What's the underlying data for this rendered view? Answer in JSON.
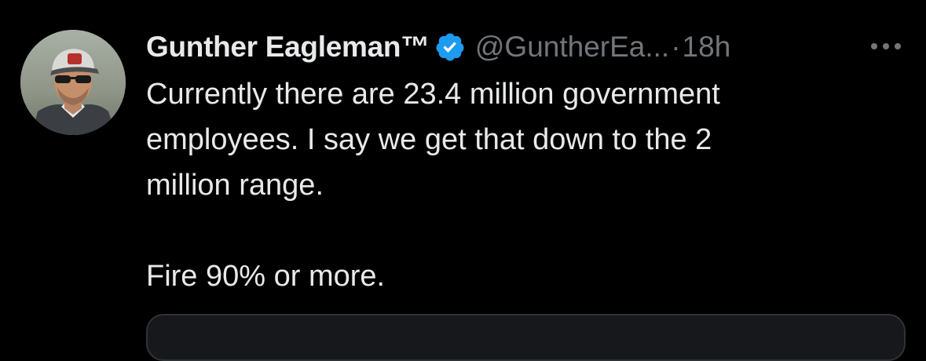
{
  "tweet": {
    "display_name": "Gunther Eagleman™",
    "handle": "@GuntherEa...",
    "separator": "·",
    "time": "18h",
    "text_lines": [
      "Currently there are 23.4 million government",
      "employees.  I say we get that down to the 2",
      "million range."
    ],
    "text_last": "Fire 90% or more.",
    "icons": {
      "verified": "verified-badge-icon",
      "more": "more-options-icon"
    },
    "colors": {
      "background": "#000000",
      "text": "#e7e9ea",
      "secondary": "#71767b",
      "verified": "#1d9bf0",
      "card_border": "#2f3336"
    }
  }
}
